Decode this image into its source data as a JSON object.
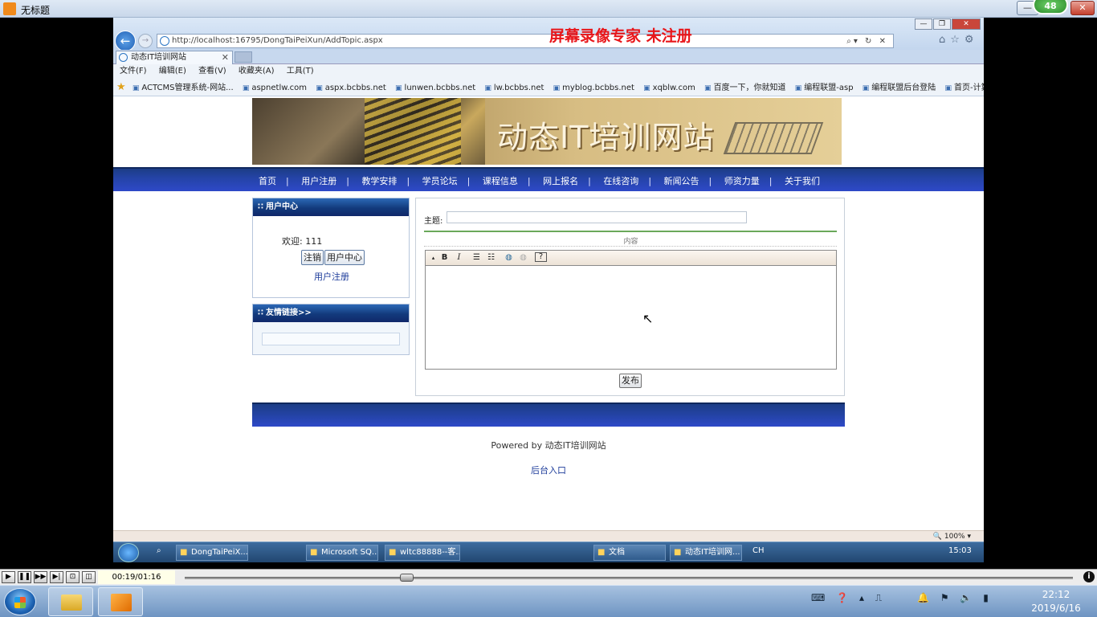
{
  "player": {
    "title": "无标题",
    "badge": "48",
    "time": "00:19/01:16",
    "progress_fraction": 0.25
  },
  "watermark": "屏幕录像专家  未注册",
  "browser": {
    "url": "http://localhost:16795/DongTaiPeiXun/AddTopic.aspx",
    "tab_title": "动态IT培训网站",
    "menu": [
      "文件(F)",
      "编辑(E)",
      "查看(V)",
      "收藏夹(A)",
      "工具(T)"
    ],
    "favorites": [
      "ACTCMS管理系统-网站...",
      "aspnetlw.com",
      "aspx.bcbbs.net",
      "lunwen.bcbbs.net",
      "lw.bcbbs.net",
      "myblog.bcbbs.net",
      "xqblw.com",
      "百度一下，你就知道",
      "编程联盟-asp",
      "编程联盟后台登陆",
      "首页-计算机软件开发-as..."
    ],
    "zoom": "100%"
  },
  "site": {
    "banner_title": "动态IT培训网站",
    "nav": [
      "首页",
      "用户注册",
      "教学安排",
      "学员论坛",
      "课程信息",
      "网上报名",
      "在线咨询",
      "新闻公告",
      "师资力量",
      "关于我们"
    ],
    "nav_sep": "|",
    "user_panel": {
      "heading": "用户中心",
      "welcome": "欢迎: 111",
      "logout": "注销",
      "user_center": "用户中心",
      "register": "用户注册"
    },
    "links_panel": {
      "heading": "友情链接>>"
    },
    "editor": {
      "subject_label": "主题:",
      "content_label": "内容",
      "publish": "发布"
    },
    "footer": {
      "powered": "Powered by 动态IT培训网站",
      "admin": "后台入口"
    }
  },
  "inner_taskbar": {
    "items": [
      "DongTaiPeiX...",
      "Microsoft SQ...",
      "wltc88888--客...",
      "文档",
      "动态IT培训网..."
    ],
    "lang": "CH",
    "time": "15:03"
  },
  "taskbar": {
    "time": "22:12",
    "date": "2019/6/16"
  }
}
